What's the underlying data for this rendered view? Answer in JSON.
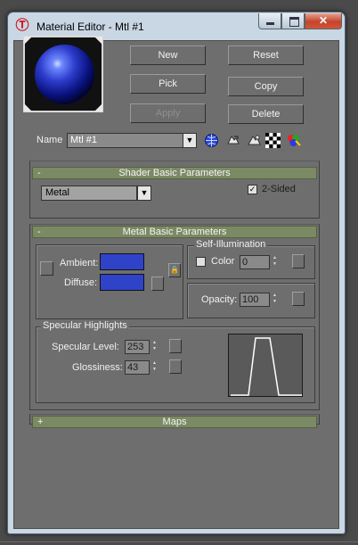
{
  "window": {
    "title": "Material Editor - Mtl #1",
    "close_glyph": "✕"
  },
  "buttons": {
    "new": "New",
    "reset": "Reset",
    "pick": "Pick",
    "copy": "Copy",
    "apply": "Apply",
    "delete": "Delete"
  },
  "name_row": {
    "label": "Name",
    "value": "Mtl #1",
    "icons": [
      "globe-icon",
      "put-to-library-icon",
      "material-effects-icon",
      "checker-background-icon",
      "color-channels-icon"
    ]
  },
  "shader_basic": {
    "title": "Shader Basic Parameters",
    "sign": "-",
    "shader_type": "Metal",
    "two_sided_label": "2-Sided",
    "two_sided_checked": true,
    "check_glyph": "✓"
  },
  "metal_basic": {
    "title": "Metal Basic Parameters",
    "sign": "-",
    "lock_glyph": "🔒",
    "ambient_label": "Ambient:",
    "diffuse_label": "Diffuse:",
    "ambient_color": "#2f43c8",
    "diffuse_color": "#2f43c8",
    "self_illumination": {
      "title": "Self-Illumination",
      "color_label": "Color",
      "color_checked": false,
      "value": "0"
    },
    "opacity": {
      "label": "Opacity:",
      "value": "100"
    },
    "specular_highlights": {
      "title": "Specular Highlights",
      "level_label": "Specular Level:",
      "level_value": "253",
      "glossiness_label": "Glossiness:",
      "glossiness_value": "43"
    }
  },
  "maps": {
    "title": "Maps",
    "sign": "+"
  },
  "spinner_glyphs": {
    "up": "▲",
    "down": "▼"
  },
  "dropdown_glyph": "▼"
}
